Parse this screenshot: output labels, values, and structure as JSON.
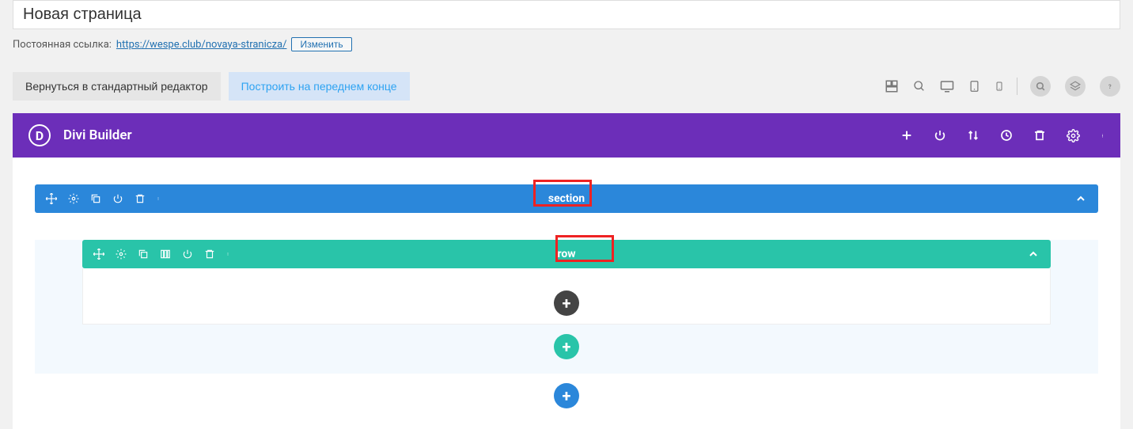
{
  "title_input_value": "Новая страница",
  "permalink": {
    "label": "Постоянная ссылка:",
    "url_text": "https://wespe.club/novaya-stranicza/",
    "edit_button": "Изменить"
  },
  "top_buttons": {
    "return_standard": "Вернуться в стандартный редактор",
    "build_frontend": "Построить на переднем конце"
  },
  "builder": {
    "logo_letter": "D",
    "title": "Divi Builder"
  },
  "bars": {
    "section_label": "section",
    "row_label": "row"
  }
}
